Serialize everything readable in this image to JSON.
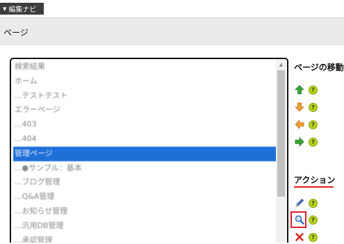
{
  "navi_tab": {
    "label": "編集ナビ",
    "arrow": "▼"
  },
  "header": {
    "title": "ページ"
  },
  "page_list": {
    "items": [
      "検索結果",
      "ホーム",
      "...テストテスト",
      "エラーページ",
      "...403",
      "...404",
      "管理ページ",
      "...●サンプル：基本",
      "...ブログ管理",
      "...Q&A管理",
      "...お知らせ管理",
      "...汎用DB管理",
      "...承認管理"
    ],
    "selected_item": "管理ページ"
  },
  "move_panel": {
    "heading": "ページの移動",
    "icons": [
      "arrow-up-icon",
      "arrow-down-icon",
      "arrow-left-icon",
      "arrow-right-icon"
    ],
    "help_label": "?"
  },
  "action_panel": {
    "heading": "アクション",
    "icons": [
      "pencil-edit-icon",
      "magnifier-search-icon",
      "delete-x-icon"
    ],
    "help_label": "?"
  },
  "colors": {
    "selection": "#1e6fd8",
    "header_bg": "#ebebeb",
    "action_underline": "#e02020",
    "highlight_box": "#d8202a",
    "help_icon": "#b8d11a"
  }
}
